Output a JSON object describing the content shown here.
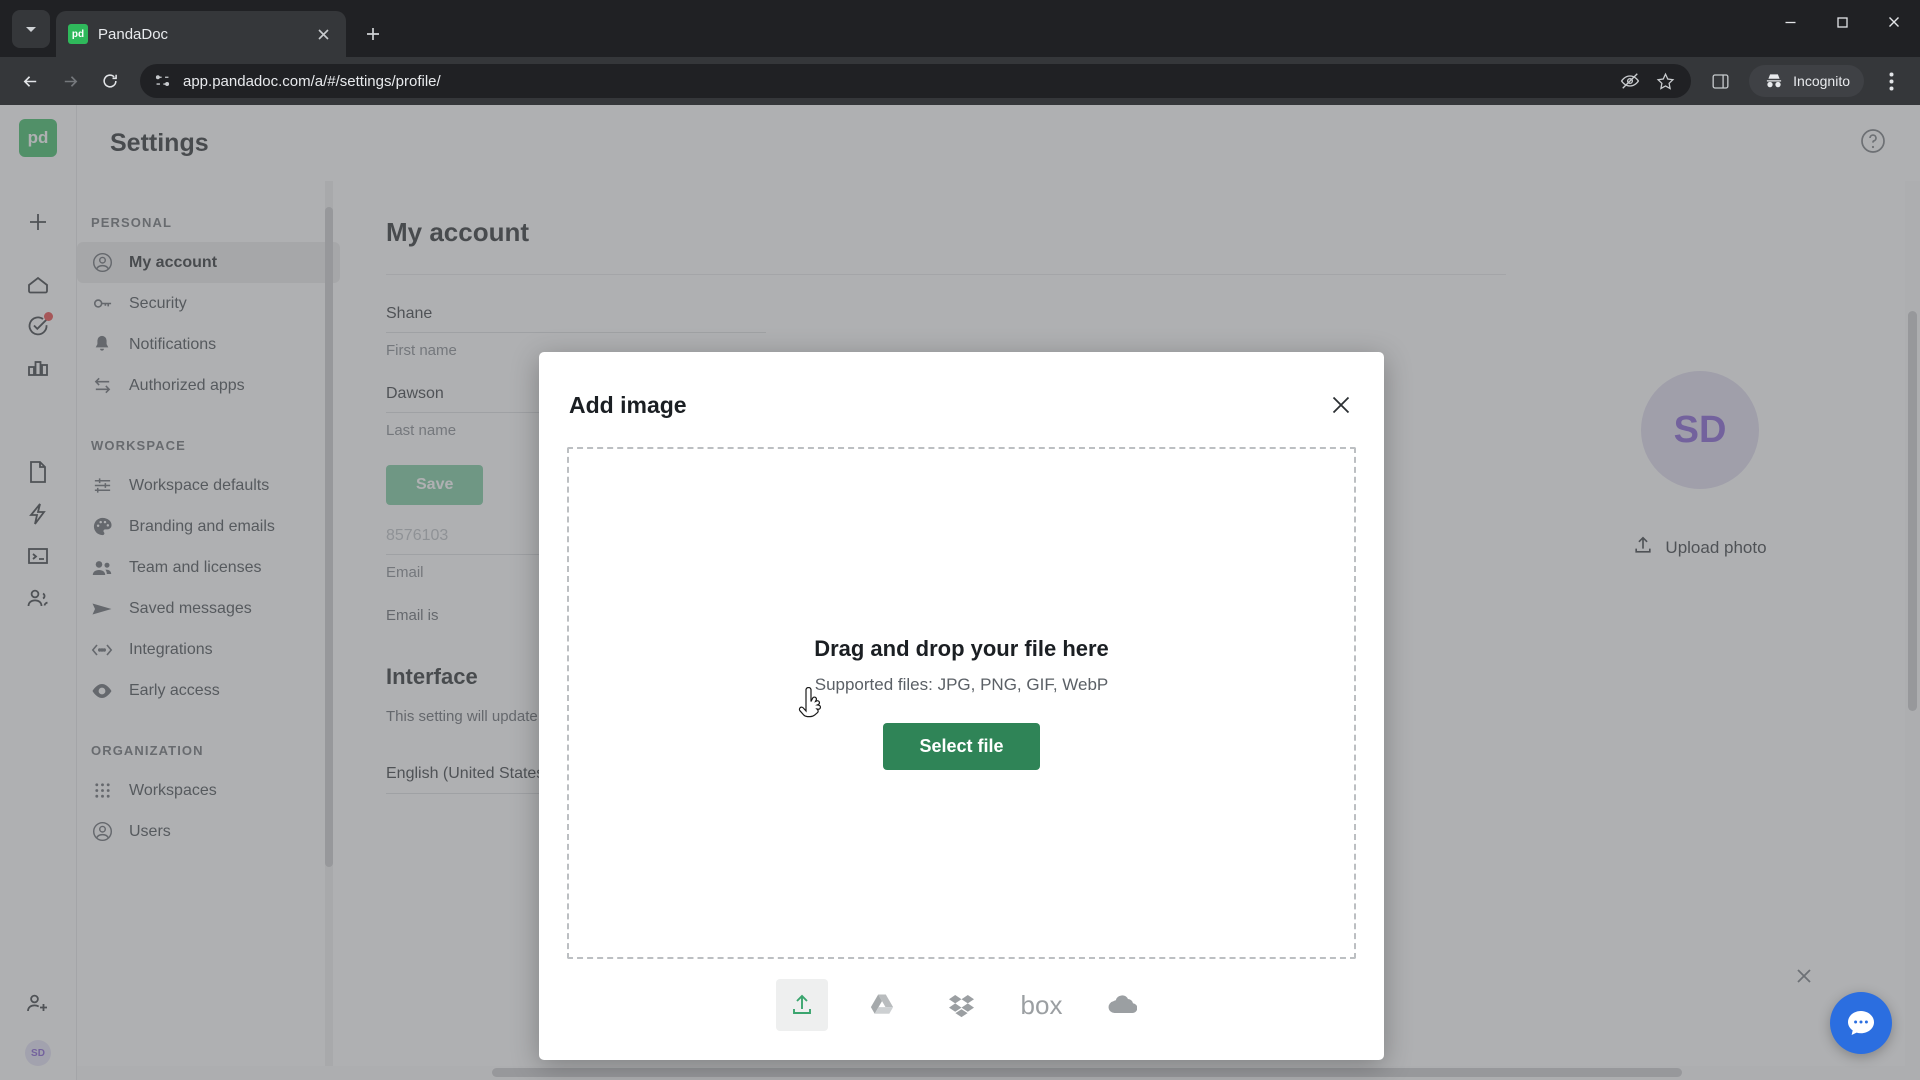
{
  "browser": {
    "tab": {
      "title": "PandaDoc",
      "favicon_label": "pd"
    },
    "url": "app.pandadoc.com/a/#/settings/profile/",
    "incognito_label": "Incognito",
    "icons": {
      "tab_search": "tab-search-icon",
      "close_tab": "close-tab-icon",
      "new_tab": "new-tab-icon",
      "minimize": "minimize-icon",
      "maximize": "maximize-icon",
      "close_window": "close-window-icon",
      "back": "back-arrow-icon",
      "forward": "forward-arrow-icon",
      "reload": "reload-icon",
      "site_info": "site-settings-icon",
      "tracking": "tracking-protection-icon",
      "bookmark": "bookmark-star-icon",
      "side_panel": "side-panel-icon",
      "incognito": "incognito-icon",
      "menu": "browser-menu-icon"
    }
  },
  "rail": {
    "logo": "pd",
    "avatar_initials": "SD",
    "items": [
      {
        "name": "create-new",
        "icon": "plus-icon"
      },
      {
        "name": "home",
        "icon": "home-icon"
      },
      {
        "name": "tasks",
        "icon": "task-check-icon",
        "badge": true
      },
      {
        "name": "reports",
        "icon": "bar-chart-icon"
      },
      {
        "name": "documents",
        "icon": "document-icon"
      },
      {
        "name": "quick-actions",
        "icon": "lightning-icon"
      },
      {
        "name": "forms",
        "icon": "form-icon"
      },
      {
        "name": "contacts",
        "icon": "contacts-icon"
      }
    ],
    "bottom": [
      {
        "name": "invite-people",
        "icon": "add-person-icon"
      }
    ]
  },
  "header": {
    "title": "Settings",
    "help_icon": "help-circle-icon"
  },
  "settings_nav": {
    "groups": [
      {
        "title": "PERSONAL",
        "items": [
          {
            "label": "My account",
            "icon": "account-circle-icon",
            "active": true
          },
          {
            "label": "Security",
            "icon": "key-icon",
            "active": false
          },
          {
            "label": "Notifications",
            "icon": "bell-icon",
            "active": false
          },
          {
            "label": "Authorized apps",
            "icon": "swap-arrows-icon",
            "active": false
          }
        ]
      },
      {
        "title": "WORKSPACE",
        "items": [
          {
            "label": "Workspace defaults",
            "icon": "sliders-icon",
            "active": false
          },
          {
            "label": "Branding and emails",
            "icon": "palette-icon",
            "active": false
          },
          {
            "label": "Team and licenses",
            "icon": "people-icon",
            "active": false
          },
          {
            "label": "Saved messages",
            "icon": "send-icon",
            "active": false
          },
          {
            "label": "Integrations",
            "icon": "code-brackets-icon",
            "active": false
          },
          {
            "label": "Early access",
            "icon": "eye-icon",
            "active": false
          }
        ]
      },
      {
        "title": "ORGANIZATION",
        "items": [
          {
            "label": "Workspaces",
            "icon": "grid-dots-icon",
            "active": false
          },
          {
            "label": "Users",
            "icon": "account-circle-icon",
            "active": false
          }
        ]
      }
    ]
  },
  "account": {
    "page_title": "My account",
    "first_name_value": "Shane",
    "first_name_label": "First name",
    "last_name_value": "Dawson",
    "last_name_label": "Last name",
    "save_label": "Save",
    "email_value": "8576103",
    "email_label": "Email",
    "email_note": "Email is",
    "avatar_initials": "SD",
    "upload_photo_label": "Upload photo",
    "upload_photo_icon": "upload-icon"
  },
  "interface": {
    "section_title": "Interface",
    "description": "This setting will update the display language.",
    "language_value": "English (United States)",
    "caret_icon": "chevron-down-icon"
  },
  "modal": {
    "title": "Add image",
    "close_icon": "close-icon",
    "dropzone_title": "Drag and drop your file here",
    "dropzone_subtitle": "Supported files: JPG, PNG, GIF, WebP",
    "select_file_label": "Select file",
    "sources": [
      {
        "name": "upload-from-computer",
        "icon": "upload-icon",
        "label": "",
        "active": true
      },
      {
        "name": "google-drive",
        "icon": "google-drive-icon",
        "label": "",
        "active": false
      },
      {
        "name": "dropbox",
        "icon": "dropbox-icon",
        "label": "",
        "active": false
      },
      {
        "name": "box",
        "icon": "box-icon",
        "label": "box",
        "active": false
      },
      {
        "name": "onedrive",
        "icon": "onedrive-icon",
        "label": "",
        "active": false
      }
    ]
  },
  "chat": {
    "fab_icon": "chat-bubble-icon",
    "close_icon": "close-icon"
  },
  "colors": {
    "brand_green": "#2fb95b",
    "button_green": "#2f8457",
    "save_green": "#72c79a",
    "avatar_purple": "#7b52d1",
    "avatar_bg": "#ddd9ee",
    "chat_blue": "#2b6ee0",
    "badge_red": "#ec3b3b"
  }
}
